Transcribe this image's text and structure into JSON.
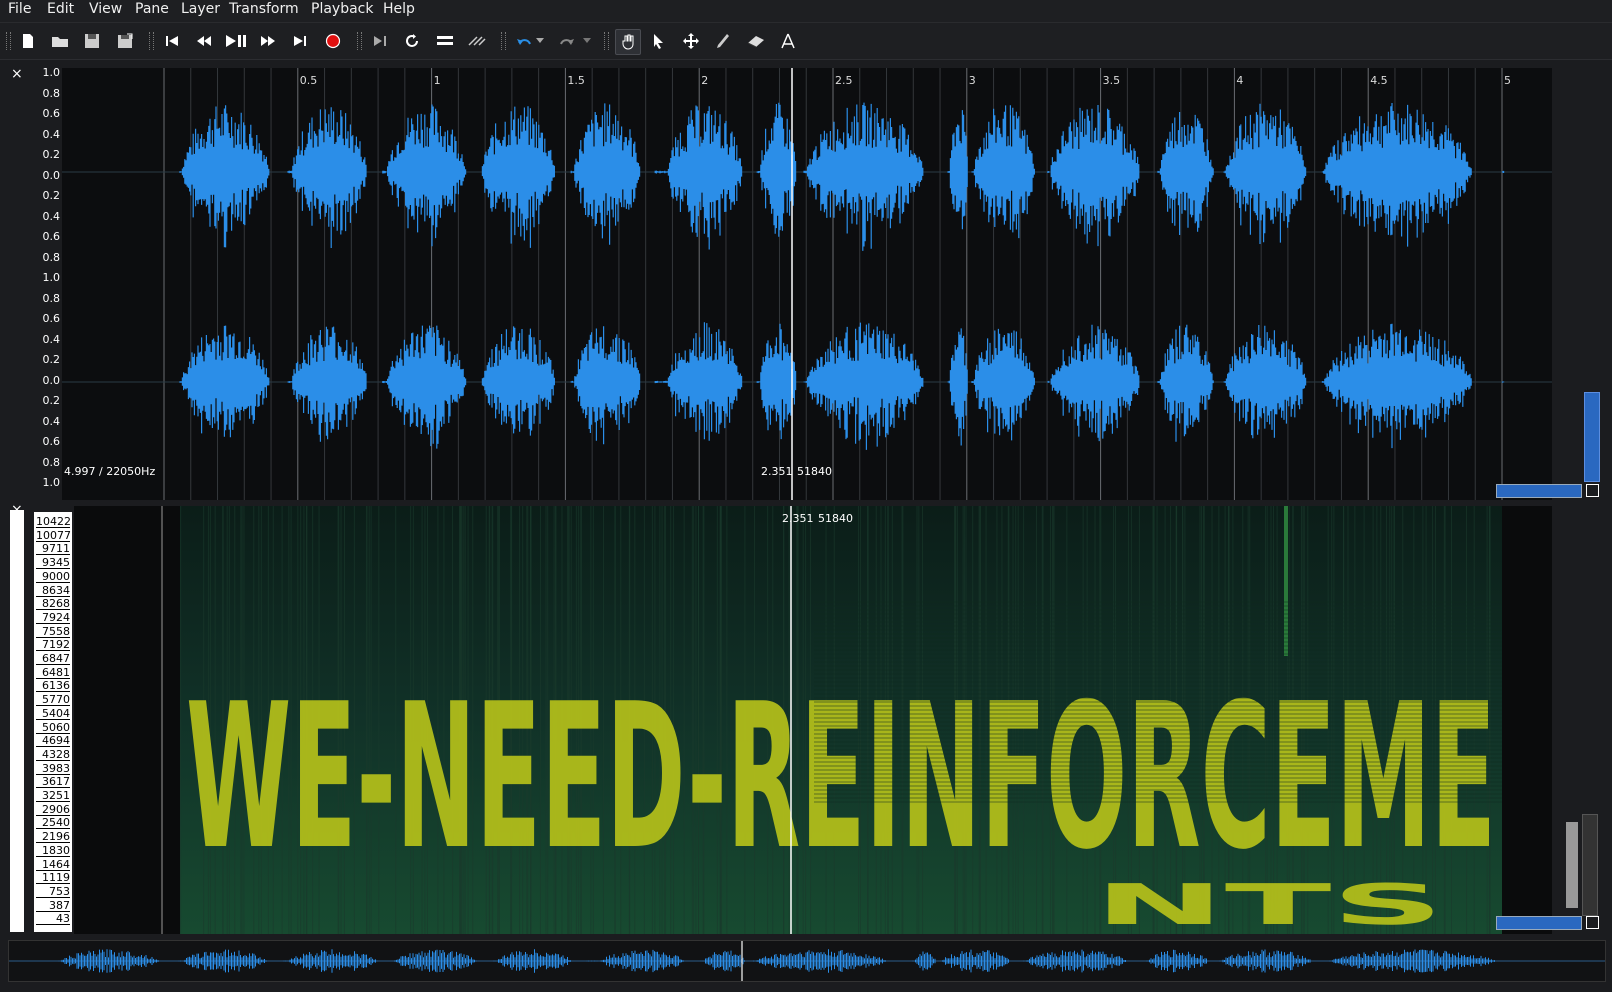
{
  "menus": [
    "File",
    "Edit",
    "View",
    "Pane",
    "Layer",
    "Transform",
    "Playback",
    "Help"
  ],
  "toolbar_icons": [
    "new-icon",
    "open-icon",
    "save-icon",
    "save-as-icon",
    "rewind-start-icon",
    "rewind-icon",
    "play-pause-icon",
    "fast-forward-icon",
    "forward-end-icon",
    "record-icon",
    "constrain-playback-icon",
    "loop-icon",
    "solo-icon",
    "align-icon",
    "undo-icon",
    "undo-dropdown-icon",
    "redo-icon",
    "redo-dropdown-icon",
    "navigate-icon",
    "select-icon",
    "move-icon",
    "draw-icon",
    "erase-icon",
    "measure-icon"
  ],
  "pane1": {
    "close": "×",
    "scale_labels": [
      "1.0",
      "0.8",
      "0.6",
      "0.4",
      "0.2",
      "0.0",
      "0.2",
      "0.4",
      "0.6",
      "0.8",
      "1.0",
      "0.8",
      "0.6",
      "0.4",
      "0.2",
      "0.0",
      "0.2",
      "0.4",
      "0.6",
      "0.8",
      "1.0"
    ],
    "time_ticks": [
      "0.5",
      "1",
      "1.5",
      "2",
      "2.5",
      "3",
      "3.5",
      "4",
      "4.5",
      "5"
    ],
    "status_left": "4.997 / 22050Hz",
    "cursor_label": "2.351",
    "cursor_frame": "51840"
  },
  "pane2": {
    "close": "×",
    "freq_labels": [
      "10422",
      "10077",
      "9711",
      "9345",
      "9000",
      "8634",
      "8268",
      "7924",
      "7558",
      "7192",
      "6847",
      "6481",
      "6136",
      "5770",
      "5404",
      "5060",
      "4694",
      "4328",
      "3983",
      "3617",
      "3251",
      "2906",
      "2540",
      "2196",
      "1830",
      "1464",
      "1119",
      "753",
      "387",
      "43"
    ],
    "cursor_label": "2.351",
    "cursor_frame": "51840",
    "overlay_text": "WE-NEED-REINFORCEME",
    "overlay_text2": "NTS"
  },
  "colors": {
    "wave": "#2b8ee8",
    "spectro_bg": "#0f2a22",
    "spectro_text": "#b9c41a"
  }
}
